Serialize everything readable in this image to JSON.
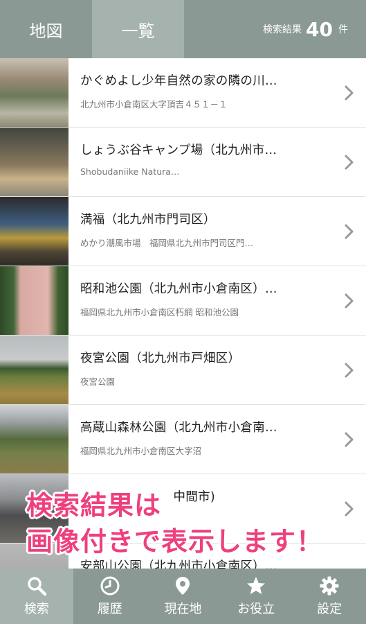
{
  "header": {
    "tabs": [
      {
        "label": "地図",
        "active": false
      },
      {
        "label": "一覧",
        "active": true
      }
    ],
    "result_label": "検索結果",
    "result_count": "40",
    "result_unit": "件"
  },
  "list": [
    {
      "title": "かぐめよし少年自然の家の隣の川…",
      "subtitle": "北九州市小倉南区大字頂吉４５１－１",
      "thumb": "river-photo"
    },
    {
      "title": "しょうぶ谷キャンプ場（北九州市…",
      "subtitle": "Shobudaniike Natura…",
      "thumb": "campsite-photo"
    },
    {
      "title": "満福（北九州市門司区）",
      "subtitle": "めかり潮風市場　福岡県北九州市門司区門…",
      "thumb": "market-photo"
    },
    {
      "title": "昭和池公園（北九州市小倉南区）…",
      "subtitle": "福岡県北九州市小倉南区朽網 昭和池公園",
      "thumb": "toilet-building-photo"
    },
    {
      "title": "夜宮公園（北九州市戸畑区）",
      "subtitle": "夜宮公園",
      "thumb": "park-field-photo"
    },
    {
      "title": "高蔵山森林公園（北九州市小倉南…",
      "subtitle": "福岡県北九州市小倉南区大字沼",
      "thumb": "forest-park-photo"
    },
    {
      "title": "中間市)",
      "subtitle": "",
      "thumb": "shrine-gate-photo"
    },
    {
      "title": "安部山公園（北九州市小倉南区）…",
      "subtitle": "",
      "thumb": "park-photo"
    }
  ],
  "overlay": {
    "line1": "検索結果は",
    "line2": "画像付きで表示します！",
    "color": "#ee3f7e"
  },
  "bottom_nav": [
    {
      "label": "検索",
      "icon": "search-icon",
      "active": true
    },
    {
      "label": "履歴",
      "icon": "clock-icon",
      "active": false
    },
    {
      "label": "現在地",
      "icon": "location-pin-icon",
      "active": false
    },
    {
      "label": "お役立",
      "icon": "star-icon",
      "active": false
    },
    {
      "label": "設定",
      "icon": "gear-icon",
      "active": false
    }
  ],
  "colors": {
    "bar": "#8b9994",
    "bar_active": "#a6b2ae"
  }
}
